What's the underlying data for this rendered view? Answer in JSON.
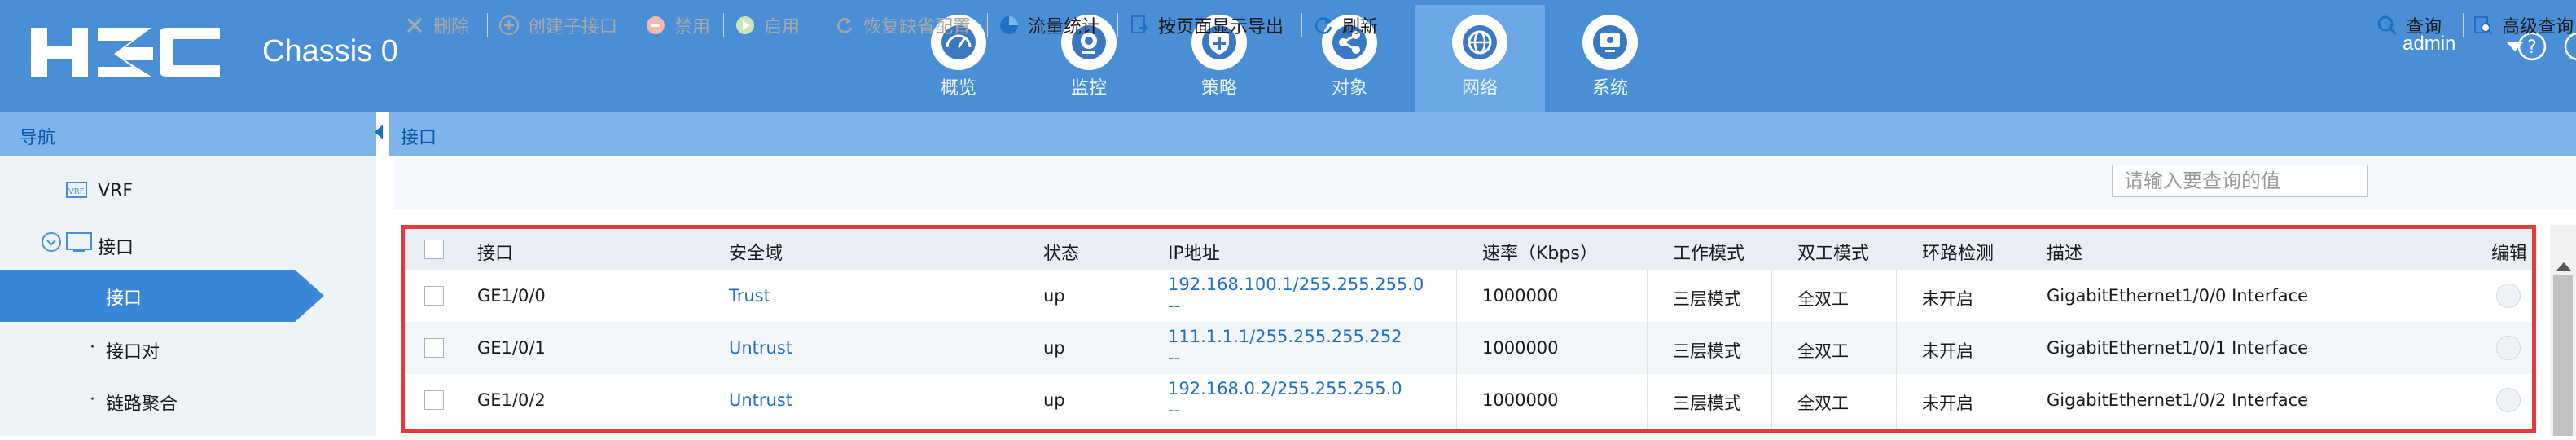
{
  "header": {
    "logo_text": "H3C",
    "device": "Chassis 0",
    "nav": [
      {
        "label": "概览",
        "icon": "dashboard-icon"
      },
      {
        "label": "监控",
        "icon": "monitor-camera-icon"
      },
      {
        "label": "策略",
        "icon": "shield-plus-icon"
      },
      {
        "label": "对象",
        "icon": "share-nodes-icon"
      },
      {
        "label": "网络",
        "icon": "globe-icon"
      },
      {
        "label": "系统",
        "icon": "system-screen-icon"
      }
    ],
    "active_nav": "网络",
    "user": "admin",
    "colors": {
      "header_bg": "#4a8fd6",
      "active_tab": "#6aa9e5"
    }
  },
  "sidebar": {
    "title": "导航",
    "items": [
      {
        "label": "VRF",
        "icon": "vrf-icon"
      },
      {
        "label": "接口",
        "icon": "interface-icon",
        "expand_icon": "collapse-icon"
      },
      {
        "label": "接口",
        "active": true
      },
      {
        "label": "接口对",
        "bullet": "·"
      },
      {
        "label": "链路聚合",
        "bullet": "·"
      }
    ]
  },
  "page": {
    "title": "接口"
  },
  "toolbar": {
    "delete": "删除",
    "create_sub": "创建子接口",
    "disable": "禁用",
    "enable": "启用",
    "restore": "恢复缺省配置",
    "traffic": "流量统计",
    "export": "按页面显示导出",
    "refresh": "刷新",
    "search_placeholder": "请输入要查询的值",
    "search": "查询",
    "advanced": "高级查询"
  },
  "table": {
    "headers": [
      "接口",
      "安全域",
      "状态",
      "IP地址",
      "速率（Kbps）",
      "工作模式",
      "双工模式",
      "环路检测",
      "描述",
      "编辑"
    ],
    "rows": [
      {
        "interface": "GE1/0/0",
        "zone": "Trust",
        "status": "up",
        "ip": "192.168.100.1/255.255.255.0",
        "ip2": "--",
        "rate": "1000000",
        "mode": "三层模式",
        "duplex": "全双工",
        "loop": "未开启",
        "desc": "GigabitEthernet1/0/0 Interface"
      },
      {
        "interface": "GE1/0/1",
        "zone": "Untrust",
        "status": "up",
        "ip": "111.1.1.1/255.255.255.252",
        "ip2": "--",
        "rate": "1000000",
        "mode": "三层模式",
        "duplex": "全双工",
        "loop": "未开启",
        "desc": "GigabitEthernet1/0/1 Interface"
      },
      {
        "interface": "GE1/0/2",
        "zone": "Untrust",
        "status": "up",
        "ip": "192.168.0.2/255.255.255.0",
        "ip2": "--",
        "rate": "1000000",
        "mode": "三层模式",
        "duplex": "全双工",
        "loop": "未开启",
        "desc": "GigabitEthernet1/0/2 Interface"
      }
    ]
  }
}
